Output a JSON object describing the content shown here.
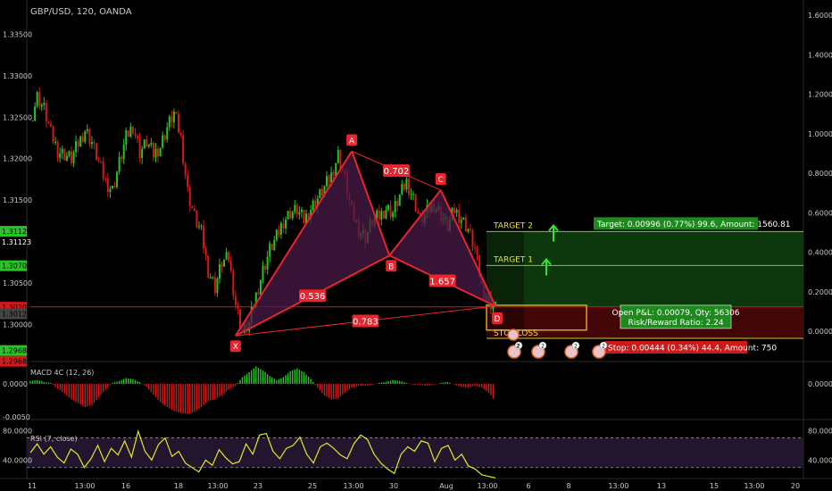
{
  "header": {
    "symbol": "GBP/USD, 120, OANDA"
  },
  "colors": {
    "background": "#000000",
    "up": "#26c426",
    "down": "#d11a1a",
    "pattern_line": "#e8252e",
    "pattern_fill": "#4a1a48",
    "target_zone": "#0e3d0e",
    "stop_zone": "#4a0808",
    "rsi_line": "#e6e62a",
    "rsi_band": "#2a1a3a",
    "target_line": "#7ccd2a",
    "entry_line": "#d11a1a",
    "text": "#c8c8c8"
  },
  "chart_data": [
    {
      "type": "candlestick",
      "title": "GBP/USD, 120, OANDA",
      "left_axis": {
        "ticks": [
          "1.33500",
          "1.33000",
          "1.32500",
          "1.32000",
          "1.31500",
          "1.30500",
          "1.30000"
        ],
        "tick_values": [
          1.335,
          1.33,
          1.325,
          1.32,
          1.315,
          1.305,
          1.3
        ],
        "price_labels": [
          {
            "text": "1.31123",
            "value": 1.31123,
            "color": "#26c426"
          },
          {
            "text": "1.31123",
            "value": 1.31123,
            "color": "#000000"
          },
          {
            "text": "1.30707",
            "value": 1.30707,
            "color": "#26c426"
          },
          {
            "text": "1.30206",
            "value": 1.30206,
            "color": "#d11a1a"
          },
          {
            "text": "1.30127",
            "value": 1.30127,
            "color": "#444444"
          },
          {
            "text": "1.29683",
            "value": 1.29683,
            "color": "#26c426"
          },
          {
            "text": "1.29683",
            "value": 1.29683,
            "color": "#d11a1a"
          }
        ]
      },
      "right_axis": {
        "ticks": [
          "1.6000",
          "1.4000",
          "1.2000",
          "1.0000",
          "0.8000",
          "0.6000",
          "0.4000",
          "0.2000",
          "0.0000"
        ],
        "range": [
          0,
          1.6
        ]
      },
      "y_range": [
        1.2955,
        1.337
      ],
      "x_ticks": [
        "11",
        "13:00",
        "16",
        "18",
        "13:00",
        "23",
        "25",
        "13:00",
        "30",
        "Aug",
        "13:00",
        "6",
        "8",
        "13:00",
        "13",
        "15",
        "13:00",
        "20"
      ],
      "close_path": [
        1.3245,
        1.3275,
        1.326,
        1.323,
        1.321,
        1.3205,
        1.32,
        1.3218,
        1.3235,
        1.322,
        1.3195,
        1.3172,
        1.3162,
        1.3195,
        1.3225,
        1.324,
        1.3208,
        1.322,
        1.3205,
        1.3215,
        1.3238,
        1.3255,
        1.3225,
        1.316,
        1.313,
        1.311,
        1.3065,
        1.3045,
        1.3075,
        1.308,
        1.3025,
        1.299,
        1.3,
        1.3035,
        1.3065,
        1.309,
        1.3105,
        1.3125,
        1.3135,
        1.3138,
        1.3125,
        1.314,
        1.3152,
        1.3165,
        1.318,
        1.3205,
        1.3175,
        1.3135,
        1.3115,
        1.3105,
        1.3125,
        1.313,
        1.314,
        1.3135,
        1.3155,
        1.3172,
        1.3152,
        1.3125,
        1.3135,
        1.3145,
        1.3133,
        1.3118,
        1.3138,
        1.3128,
        1.3115,
        1.309,
        1.3045,
        1.3028,
        1.302
      ],
      "harmonic_pattern": {
        "points": [
          {
            "label": "X",
            "x_frac": 0.3,
            "price": 1.2986
          },
          {
            "label": "A",
            "x_frac": 0.47,
            "price": 1.3209
          },
          {
            "label": "B",
            "x_frac": 0.525,
            "price": 1.3083
          },
          {
            "label": "C",
            "x_frac": 0.6,
            "price": 1.3162
          },
          {
            "label": "D",
            "x_frac": 0.68,
            "price": 1.3022
          }
        ],
        "ratios": [
          {
            "text": "0.702",
            "from": "A",
            "to": "C"
          },
          {
            "text": "0.536",
            "from": "X",
            "to": "B"
          },
          {
            "text": "1.657",
            "from": "B",
            "to": "D"
          },
          {
            "text": "0.783",
            "from": "X",
            "to": "D"
          }
        ]
      },
      "trade": {
        "target2_label": "TARGET 2",
        "target1_label": "TARGET 1",
        "stop_label": "STOP LOSS",
        "target2_price": 1.3112,
        "target1_price": 1.3071,
        "entry_price": 1.3021,
        "stop_price": 1.2983,
        "target_box_text": "Target: 0.00996 (0.77%) 99.6, Amount: 1560.81",
        "open_pl_text": "Open P&L: 0.00079, Qty: 56306",
        "risk_reward_text": "Risk/Reward Ratio: 2.24",
        "stop_box_text": "Stop: 0.00444 (0.34%) 44.4, Amount: 750"
      },
      "event_markers": [
        "2",
        "2",
        "2",
        "2",
        "2"
      ]
    },
    {
      "type": "histogram",
      "title": "MACD 4C (12, 26)",
      "left_axis": {
        "ticks": [
          "0.0000",
          "-0.0050"
        ]
      },
      "right_axis": {
        "ticks": [
          "0.0000"
        ]
      },
      "values": [
        0.0003,
        0.0004,
        0.0002,
        0.0001,
        -0.0005,
        -0.001,
        -0.0016,
        -0.002,
        -0.0024,
        -0.0022,
        -0.0014,
        -0.0006,
        0.0001,
        0.0003,
        0.0006,
        0.0005,
        0.0002,
        -0.0003,
        -0.0011,
        -0.0019,
        -0.0024,
        -0.0028,
        -0.003,
        -0.0031,
        -0.0029,
        -0.0024,
        -0.0018,
        -0.0016,
        -0.0012,
        -0.0006,
        -0.0002,
        0.0007,
        0.0012,
        0.0018,
        0.0014,
        0.0008,
        0.0004,
        0.0007,
        0.0013,
        0.0016,
        0.0012,
        0.0005,
        -0.0004,
        -0.0012,
        -0.0016,
        -0.0015,
        -0.0009,
        -0.0004,
        -0.0002,
        -0.0002,
        -0.0001,
        0.0001,
        0.0002,
        0.0004,
        0.0003,
        0.0001,
        -0.0001,
        -0.0001,
        -0.0002,
        -0.0001,
        0.0001,
        0.0002,
        -0.0001,
        -0.0003,
        -0.0004,
        -0.0002,
        -0.0004,
        -0.0009,
        -0.0018
      ]
    },
    {
      "type": "line",
      "title": "RSI (7, close)",
      "left_axis": {
        "ticks": [
          "80.0000",
          "40.0000"
        ]
      },
      "right_axis": {
        "ticks": [
          "80.0000",
          "40.0000"
        ]
      },
      "ylim": [
        0,
        100
      ],
      "bands": [
        70,
        30
      ],
      "values": [
        50,
        62,
        48,
        58,
        44,
        36,
        55,
        48,
        30,
        42,
        60,
        38,
        56,
        47,
        66,
        44,
        79,
        52,
        40,
        61,
        70,
        45,
        52,
        36,
        30,
        24,
        40,
        33,
        54,
        43,
        35,
        38,
        62,
        48,
        74,
        76,
        52,
        42,
        56,
        60,
        71,
        48,
        36,
        58,
        63,
        56,
        47,
        42,
        62,
        74,
        68,
        48,
        36,
        28,
        22,
        48,
        58,
        52,
        66,
        63,
        38,
        56,
        60,
        40,
        48,
        32,
        28,
        20,
        18,
        16
      ]
    }
  ]
}
